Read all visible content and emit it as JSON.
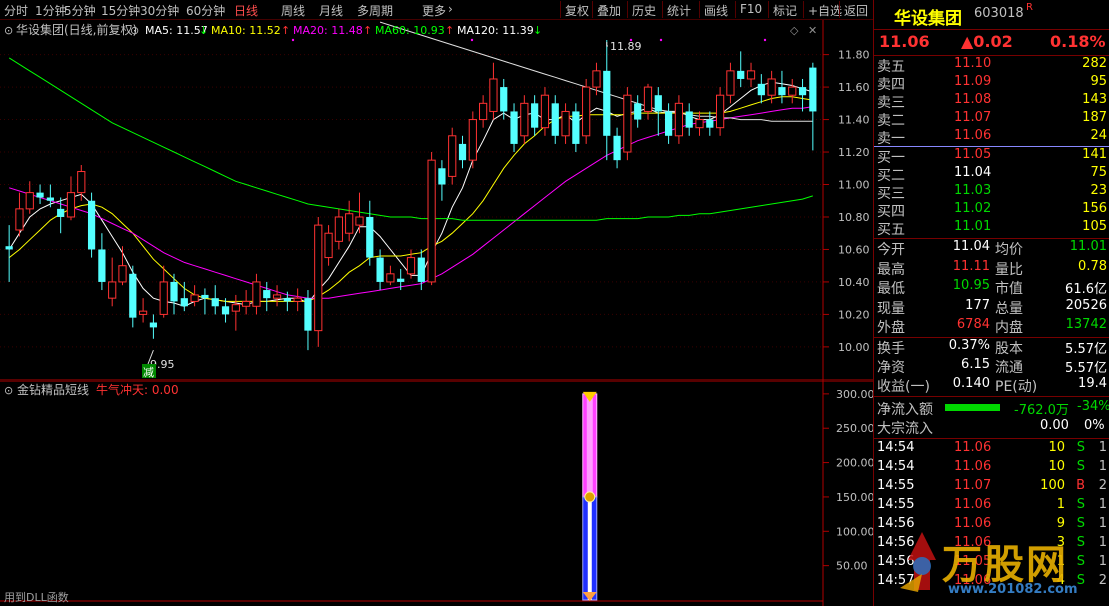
{
  "toolbar": {
    "left_tabs": [
      "分时",
      "1分钟",
      "5分钟",
      "15分钟",
      "30分钟",
      "60分钟",
      "日线",
      "周线",
      "月线",
      "多周期",
      "更多"
    ],
    "active_tab": "日线",
    "right_buttons": [
      "复权",
      "叠加",
      "历史",
      "统计",
      "画线",
      "F10",
      "标记",
      "+自选",
      "返回"
    ]
  },
  "main": {
    "stock_label": "华设集团(日线,前复权)",
    "ma": [
      {
        "label": "MA5: 11.57",
        "color": "#ffffff"
      },
      {
        "label": "MA10: 11.52",
        "color": "#ffff00"
      },
      {
        "label": "MA20: 11.48",
        "color": "#ff00ff"
      },
      {
        "label": "MA60: 10.93",
        "color": "#00ff00"
      },
      {
        "label": "MA120: 11.39",
        "color": "#ffffff"
      }
    ],
    "price_axis": [
      "11.80",
      "11.60",
      "11.40",
      "11.20",
      "11.00",
      "10.80",
      "10.60",
      "10.40",
      "10.20",
      "10.00"
    ],
    "high_marker": "11.89",
    "low_marker": "9.95",
    "low_badge": "减"
  },
  "indicator": {
    "name": "金钻精品短线",
    "series_label": "牛气冲天: 0.00",
    "axis": [
      "300.00",
      "250.00",
      "200.00",
      "150.00",
      "100.00",
      "50.00"
    ],
    "bottom_note": "用到DLL函数"
  },
  "quote": {
    "name": "华设集团",
    "code": "603018",
    "badge": "R",
    "price": "11.06",
    "change": "▲0.02",
    "pct": "0.18%",
    "asks": [
      {
        "label": "卖五",
        "price": "11.10",
        "vol": "282"
      },
      {
        "label": "卖四",
        "price": "11.09",
        "vol": "95"
      },
      {
        "label": "卖三",
        "price": "11.08",
        "vol": "143"
      },
      {
        "label": "卖二",
        "price": "11.07",
        "vol": "187"
      },
      {
        "label": "卖一",
        "price": "11.06",
        "vol": "24"
      }
    ],
    "bids": [
      {
        "label": "买一",
        "price": "11.05",
        "vol": "141"
      },
      {
        "label": "买二",
        "price": "11.04",
        "vol": "75"
      },
      {
        "label": "买三",
        "price": "11.03",
        "vol": "23"
      },
      {
        "label": "买四",
        "price": "11.02",
        "vol": "156"
      },
      {
        "label": "买五",
        "price": "11.01",
        "vol": "105"
      }
    ],
    "stats": [
      {
        "l1": "今开",
        "v1": "11.04",
        "l2": "均价",
        "v2": "11.01"
      },
      {
        "l1": "最高",
        "v1": "11.11",
        "l2": "量比",
        "v2": "0.78"
      },
      {
        "l1": "最低",
        "v1": "10.95",
        "l2": "市值",
        "v2": "61.6亿"
      },
      {
        "l1": "现量",
        "v1": "177",
        "l2": "总量",
        "v2": "20526"
      },
      {
        "l1": "外盘",
        "v1": "6784",
        "l2": "内盘",
        "v2": "13742"
      }
    ],
    "stats2": [
      {
        "l1": "换手",
        "v1": "0.37%",
        "l2": "股本",
        "v2": "5.57亿"
      },
      {
        "l1": "净资",
        "v1": "6.15",
        "l2": "流通",
        "v2": "5.57亿"
      },
      {
        "l1": "收益(一)",
        "v1": "0.140",
        "l2": "PE(动)",
        "v2": "19.4"
      }
    ],
    "net_inflow": {
      "label": "净流入额",
      "value": "-762.0万",
      "pct": "-34%"
    },
    "block_inflow": {
      "label": "大宗流入",
      "value": "0.00",
      "pct": "0%"
    },
    "ticks": [
      {
        "time": "14:54",
        "price": "11.06",
        "vol": "10",
        "side": "S",
        "n": "1"
      },
      {
        "time": "14:54",
        "price": "11.06",
        "vol": "10",
        "side": "S",
        "n": "1"
      },
      {
        "time": "14:55",
        "price": "11.07",
        "vol": "100",
        "side": "B",
        "n": "2"
      },
      {
        "time": "14:55",
        "price": "11.06",
        "vol": "1",
        "side": "S",
        "n": "1"
      },
      {
        "time": "14:56",
        "price": "11.06",
        "vol": "9",
        "side": "S",
        "n": "1"
      },
      {
        "time": "14:56",
        "price": "11.06",
        "vol": "3",
        "side": "S",
        "n": "1"
      },
      {
        "time": "14:56",
        "price": "11.05",
        "vol": "1",
        "side": "S",
        "n": "1"
      },
      {
        "time": "14:57",
        "price": "11.06",
        "vol": "4",
        "side": "S",
        "n": "2"
      }
    ]
  },
  "watermark": {
    "brand": "万股网",
    "url": "www.201082.com"
  },
  "chart_data": {
    "type": "candlestick",
    "ylim": [
      9.95,
      11.89
    ],
    "up_color": "#ff3232",
    "down_color": "#54ffff",
    "candles": [
      [
        10.62,
        10.6,
        10.75,
        10.4
      ],
      [
        10.72,
        10.85,
        10.95,
        10.68
      ],
      [
        10.85,
        10.95,
        11.02,
        10.82
      ],
      [
        10.95,
        10.92,
        11.0,
        10.88
      ],
      [
        10.92,
        10.9,
        11.0,
        10.86
      ],
      [
        10.85,
        10.8,
        10.92,
        10.7
      ],
      [
        10.8,
        10.95,
        11.05,
        10.78
      ],
      [
        10.95,
        11.08,
        11.12,
        10.9
      ],
      [
        10.9,
        10.6,
        10.95,
        10.55
      ],
      [
        10.6,
        10.4,
        10.7,
        10.35
      ],
      [
        10.3,
        10.4,
        10.55,
        10.25
      ],
      [
        10.4,
        10.5,
        10.62,
        10.38
      ],
      [
        10.45,
        10.18,
        10.5,
        10.12
      ],
      [
        10.2,
        10.22,
        10.3,
        10.15
      ],
      [
        10.15,
        10.12,
        10.2,
        10.05
      ],
      [
        10.2,
        10.4,
        10.5,
        10.18
      ],
      [
        10.4,
        10.28,
        10.45,
        10.2
      ],
      [
        10.3,
        10.25,
        10.4,
        10.22
      ],
      [
        10.28,
        10.32,
        10.38,
        10.25
      ],
      [
        10.32,
        10.3,
        10.36,
        10.2
      ],
      [
        10.3,
        10.25,
        10.38,
        10.2
      ],
      [
        10.25,
        10.2,
        10.3,
        10.15
      ],
      [
        10.22,
        10.26,
        10.32,
        10.1
      ],
      [
        10.25,
        10.28,
        10.35,
        10.2
      ],
      [
        10.25,
        10.4,
        10.45,
        10.2
      ],
      [
        10.35,
        10.3,
        10.4,
        10.22
      ],
      [
        10.3,
        10.32,
        10.38,
        10.25
      ],
      [
        10.3,
        10.28,
        10.34,
        10.22
      ],
      [
        10.28,
        10.3,
        10.36,
        10.22
      ],
      [
        10.3,
        10.1,
        10.35,
        9.98
      ],
      [
        10.1,
        10.75,
        10.8,
        10.0
      ],
      [
        10.55,
        10.7,
        10.75,
        10.5
      ],
      [
        10.65,
        10.8,
        10.85,
        10.6
      ],
      [
        10.7,
        10.82,
        10.9,
        10.65
      ],
      [
        10.75,
        10.8,
        10.95,
        10.7
      ],
      [
        10.8,
        10.55,
        10.9,
        10.5
      ],
      [
        10.55,
        10.4,
        10.6,
        10.35
      ],
      [
        10.4,
        10.45,
        10.5,
        10.38
      ],
      [
        10.42,
        10.4,
        10.48,
        10.35
      ],
      [
        10.45,
        10.55,
        10.6,
        10.42
      ],
      [
        10.55,
        10.4,
        10.6,
        10.35
      ],
      [
        10.4,
        11.15,
        11.2,
        10.38
      ],
      [
        11.1,
        11.0,
        11.15,
        10.9
      ],
      [
        11.05,
        11.3,
        11.35,
        11.0
      ],
      [
        11.25,
        11.15,
        11.3,
        11.1
      ],
      [
        11.15,
        11.4,
        11.45,
        11.1
      ],
      [
        11.4,
        11.5,
        11.55,
        11.35
      ],
      [
        11.45,
        11.65,
        11.75,
        11.4
      ],
      [
        11.6,
        11.45,
        11.65,
        11.4
      ],
      [
        11.45,
        11.25,
        11.5,
        11.2
      ],
      [
        11.3,
        11.5,
        11.55,
        11.25
      ],
      [
        11.5,
        11.35,
        11.55,
        11.3
      ],
      [
        11.35,
        11.55,
        11.6,
        11.3
      ],
      [
        11.5,
        11.3,
        11.55,
        11.25
      ],
      [
        11.3,
        11.45,
        11.5,
        11.25
      ],
      [
        11.45,
        11.25,
        11.5,
        11.2
      ],
      [
        11.3,
        11.6,
        11.65,
        11.25
      ],
      [
        11.6,
        11.7,
        11.75,
        11.55
      ],
      [
        11.7,
        11.3,
        11.89,
        11.15
      ],
      [
        11.3,
        11.15,
        11.35,
        11.1
      ],
      [
        11.2,
        11.55,
        11.6,
        11.15
      ],
      [
        11.5,
        11.4,
        11.55,
        11.35
      ],
      [
        11.45,
        11.6,
        11.62,
        11.4
      ],
      [
        11.55,
        11.45,
        11.6,
        11.3
      ],
      [
        11.45,
        11.3,
        11.5,
        11.25
      ],
      [
        11.3,
        11.5,
        11.55,
        11.25
      ],
      [
        11.45,
        11.35,
        11.5,
        11.3
      ],
      [
        11.35,
        11.4,
        11.45,
        11.3
      ],
      [
        11.4,
        11.35,
        11.45,
        11.3
      ],
      [
        11.35,
        11.55,
        11.6,
        11.3
      ],
      [
        11.55,
        11.7,
        11.75,
        11.5
      ],
      [
        11.7,
        11.65,
        11.82,
        11.6
      ],
      [
        11.65,
        11.7,
        11.75,
        11.6
      ],
      [
        11.62,
        11.55,
        11.68,
        11.5
      ],
      [
        11.55,
        11.65,
        11.7,
        11.5
      ],
      [
        11.6,
        11.55,
        11.7,
        11.5
      ],
      [
        11.55,
        11.6,
        11.65,
        11.5
      ],
      [
        11.6,
        11.55,
        11.65,
        11.45
      ],
      [
        11.72,
        11.45,
        11.75,
        11.21
      ]
    ],
    "ma_series": [
      {
        "name": "MA5",
        "color": "#ffffff",
        "values": [
          10.6,
          10.7,
          10.8,
          10.85,
          10.88,
          10.9,
          10.92,
          10.94,
          10.88,
          10.78,
          10.68,
          10.58,
          10.46,
          10.36,
          10.3,
          10.28,
          10.27,
          10.25,
          10.28,
          10.3,
          10.29,
          10.28,
          10.27,
          10.26,
          10.28,
          10.28,
          10.29,
          10.3,
          10.3,
          10.27,
          10.35,
          10.42,
          10.52,
          10.62,
          10.74,
          10.74,
          10.68,
          10.6,
          10.52,
          10.44,
          10.44,
          10.58,
          10.7,
          10.86,
          10.98,
          11.15,
          11.27,
          11.4,
          11.44,
          11.4,
          11.43,
          11.44,
          11.4,
          11.4,
          11.43,
          11.38,
          11.43,
          11.47,
          11.45,
          11.42,
          11.44,
          11.45,
          11.47,
          11.44,
          11.45,
          11.45,
          11.42,
          11.4,
          11.4,
          11.43,
          11.48,
          11.53,
          11.58,
          11.61,
          11.63,
          11.62,
          11.61,
          11.59,
          11.57
        ]
      },
      {
        "name": "MA10",
        "color": "#ffff00",
        "values": [
          10.55,
          10.6,
          10.66,
          10.72,
          10.78,
          10.82,
          10.85,
          10.87,
          10.88,
          10.86,
          10.82,
          10.76,
          10.7,
          10.62,
          10.54,
          10.48,
          10.42,
          10.36,
          10.32,
          10.3,
          10.29,
          10.28,
          10.28,
          10.28,
          10.28,
          10.28,
          10.28,
          10.28,
          10.28,
          10.28,
          10.31,
          10.35,
          10.4,
          10.46,
          10.5,
          10.55,
          10.56,
          10.56,
          10.56,
          10.57,
          10.58,
          10.62,
          10.65,
          10.7,
          10.76,
          10.82,
          10.9,
          11.0,
          11.1,
          11.18,
          11.25,
          11.3,
          11.36,
          11.4,
          11.42,
          11.42,
          11.43,
          11.43,
          11.43,
          11.43,
          11.43,
          11.44,
          11.44,
          11.44,
          11.44,
          11.44,
          11.44,
          11.44,
          11.44,
          11.44,
          11.45,
          11.47,
          11.49,
          11.51,
          11.53,
          11.54,
          11.54,
          11.53,
          11.52
        ]
      },
      {
        "name": "MA20",
        "color": "#ff00ff",
        "values": [
          10.98,
          10.96,
          10.94,
          10.92,
          10.9,
          10.88,
          10.86,
          10.84,
          10.82,
          10.79,
          10.76,
          10.73,
          10.7,
          10.66,
          10.62,
          10.58,
          10.55,
          10.52,
          10.5,
          10.48,
          10.46,
          10.44,
          10.42,
          10.4,
          10.38,
          10.36,
          10.34,
          10.32,
          10.31,
          10.3,
          10.3,
          10.3,
          10.31,
          10.32,
          10.33,
          10.34,
          10.35,
          10.36,
          10.37,
          10.38,
          10.39,
          10.42,
          10.45,
          10.49,
          10.53,
          10.57,
          10.62,
          10.67,
          10.72,
          10.77,
          10.82,
          10.87,
          10.92,
          10.97,
          11.02,
          11.06,
          11.1,
          11.14,
          11.18,
          11.21,
          11.24,
          11.27,
          11.29,
          11.31,
          11.33,
          11.35,
          11.37,
          11.38,
          11.39,
          11.4,
          11.41,
          11.42,
          11.43,
          11.44,
          11.45,
          11.46,
          11.47,
          11.47,
          11.48
        ]
      },
      {
        "name": "MA60",
        "color": "#00ff00",
        "values": [
          11.78,
          11.74,
          11.7,
          11.66,
          11.62,
          11.58,
          11.54,
          11.5,
          11.46,
          11.42,
          11.38,
          11.35,
          11.32,
          11.29,
          11.26,
          11.23,
          11.2,
          11.17,
          11.14,
          11.11,
          11.08,
          11.05,
          11.02,
          11.0,
          10.98,
          10.96,
          10.94,
          10.92,
          10.9,
          10.88,
          10.87,
          10.86,
          10.85,
          10.84,
          10.83,
          10.82,
          10.81,
          10.8,
          10.8,
          10.8,
          10.79,
          10.79,
          10.79,
          10.79,
          10.78,
          10.78,
          10.78,
          10.78,
          10.78,
          10.78,
          10.78,
          10.78,
          10.78,
          10.78,
          10.78,
          10.78,
          10.78,
          10.78,
          10.79,
          10.79,
          10.79,
          10.79,
          10.8,
          10.8,
          10.8,
          10.81,
          10.81,
          10.82,
          10.82,
          10.83,
          10.84,
          10.85,
          10.86,
          10.87,
          10.88,
          10.89,
          10.9,
          10.91,
          10.93
        ]
      },
      {
        "name": "MA120",
        "color": "#e0e0e0",
        "start_index": 36,
        "values": [
          12.0,
          11.98,
          11.96,
          11.94,
          11.92,
          11.9,
          11.88,
          11.86,
          11.84,
          11.82,
          11.8,
          11.78,
          11.76,
          11.74,
          11.72,
          11.7,
          11.68,
          11.66,
          11.64,
          11.62,
          11.6,
          11.58,
          11.56,
          11.54,
          11.52,
          11.5,
          11.48,
          11.46,
          11.45,
          11.44,
          11.43,
          11.42,
          11.42,
          11.41,
          11.41,
          11.4,
          11.4,
          11.4,
          11.39,
          11.39,
          11.39,
          11.39,
          11.39
        ]
      }
    ],
    "indicator_bar": {
      "x_index": 58,
      "top_value": 300,
      "split_value": 150,
      "bottom_value": 0,
      "ylim": [
        0,
        310
      ]
    }
  }
}
